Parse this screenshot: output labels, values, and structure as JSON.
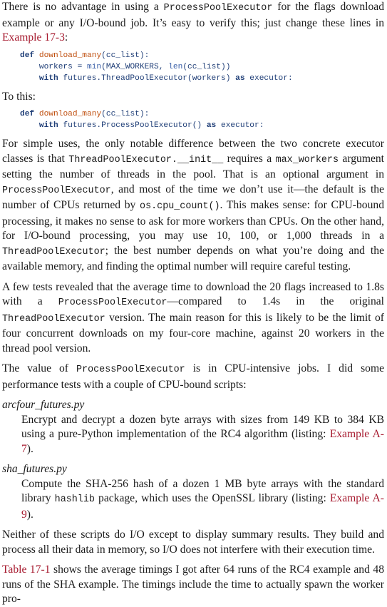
{
  "p1": {
    "a": "There is no advantage in using a ",
    "code1": "ProcessPoolExecutor",
    "b": " for the flags download example or any I/O-bound job. It’s easy to verify this; just change these lines in ",
    "ref": "Example 17-3",
    "c": ":"
  },
  "code1": {
    "l1": {
      "kw": "def",
      "sp": " ",
      "fn": "download_many",
      "rest": "(cc_list):"
    },
    "l2": {
      "indent": "    ",
      "a": "workers = ",
      "b1": "min",
      "b": "(MAX_WORKERS, ",
      "b2": "len",
      "c": "(cc_list))"
    },
    "l3": {
      "indent": "    ",
      "kw": "with",
      "a": " futures.ThreadPoolExecutor(workers) ",
      "kw2": "as",
      "b": " executor:"
    }
  },
  "to_this": "To this:",
  "code2": {
    "l1": {
      "kw": "def",
      "sp": " ",
      "fn": "download_many",
      "rest": "(cc_list):"
    },
    "l2": {
      "indent": "    ",
      "kw": "with",
      "a": " futures.ProcessPoolExecutor() ",
      "kw2": "as",
      "b": " executor:"
    }
  },
  "p2": {
    "a": "For simple uses, the only notable difference between the two concrete executor classes is that ",
    "c1": "ThreadPoolExecutor.__init__",
    "b": " requires a ",
    "c2": "max_workers",
    "c": " argument setting the number of threads in the pool. That is an optional argument in ",
    "c3": "ProcessPoolExecutor",
    "d": ", and most of the time we don’t use it—the default is the number of CPUs returned by ",
    "c4": "os.cpu_count()",
    "e": ". This makes sense: for CPU-bound processing, it makes no sense to ask for more workers than CPUs. On the other hand, for I/O-bound processing, you may use 10, 100, or 1,000 threads in a ",
    "c5": "ThreadPoolExecutor",
    "f": "; the best number depends on what you’re doing and the available memory, and finding the optimal number will require careful testing."
  },
  "p3": {
    "a": "A few tests revealed that the average time to download the 20 flags increased to 1.8s with a ",
    "c1": "ProcessPoolExecutor",
    "b": "—compared to 1.4s in the original ",
    "c2": "ThreadPoolExecutor",
    "c": " version. The main reason for this is likely to be the limit of four concurrent downloads on my four-core machine, against 20 workers in the thread pool version."
  },
  "p4": {
    "a": "The value of ",
    "c1": "ProcessPoolExecutor",
    "b": " is in CPU-intensive jobs. I did some performance tests with a couple of CPU-bound scripts:"
  },
  "dl": [
    {
      "term": "arcfour_futures.py",
      "def_a": "Encrypt and decrypt a dozen byte arrays with sizes from 149 KB to 384 KB using a pure-Python implementation of the RC4 algorithm (listing: ",
      "ref": "Example A-7",
      "def_b": ")."
    },
    {
      "term": "sha_futures.py",
      "def_a": "Compute the SHA-256 hash of a dozen 1 MB byte arrays with the standard library ",
      "code": "hashlib",
      "def_b": " package, which uses the OpenSSL library (listing: ",
      "ref": "Example A-9",
      "def_c": ")."
    }
  ],
  "p5": "Neither of these scripts do I/O except to display summary results. They build and process all their data in memory, so I/O does not interfere with their execution time.",
  "p6": {
    "ref": "Table 17-1",
    "a": " shows the average timings I got after 64 runs of the RC4 example and 48 runs of the SHA example. The timings include the time to actually spawn the worker pro-"
  },
  "colors": {
    "text": "#1a1a1a",
    "xref": "#a6192e",
    "code_keyword": "#1f3e77",
    "code_function": "#c05010"
  }
}
